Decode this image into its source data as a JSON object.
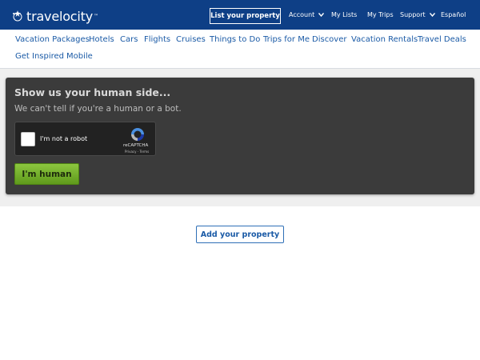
{
  "header": {
    "logo_text": "travelocity",
    "logo_tm": "™",
    "list_property": "List your property",
    "account": "Account",
    "my_lists": "My Lists",
    "my_trips": "My Trips",
    "support": "Support",
    "language": "Español"
  },
  "nav": {
    "items": [
      "Vacation Packages",
      "Hotels",
      "Cars",
      "Flights",
      "Cruises",
      "Things to Do",
      "Trips for Me",
      "Discover",
      "Vacation Rentals",
      "Travel Deals",
      "Get Inspired",
      "Mobile"
    ]
  },
  "challenge": {
    "title": "Show us your human side...",
    "subtitle": "We can't tell if you're a human or a bot.",
    "captcha_label": "I'm not a robot",
    "captcha_brand": "reCAPTCHA",
    "captcha_links": "Privacy - Terms",
    "submit_label": "I'm human"
  },
  "footer": {
    "add_property": "Add your property"
  },
  "colors": {
    "header_bg": "#0e3f86",
    "link": "#1a5aa6",
    "panel_bg": "#3b3b3b",
    "button_green": "#7ab51d"
  }
}
